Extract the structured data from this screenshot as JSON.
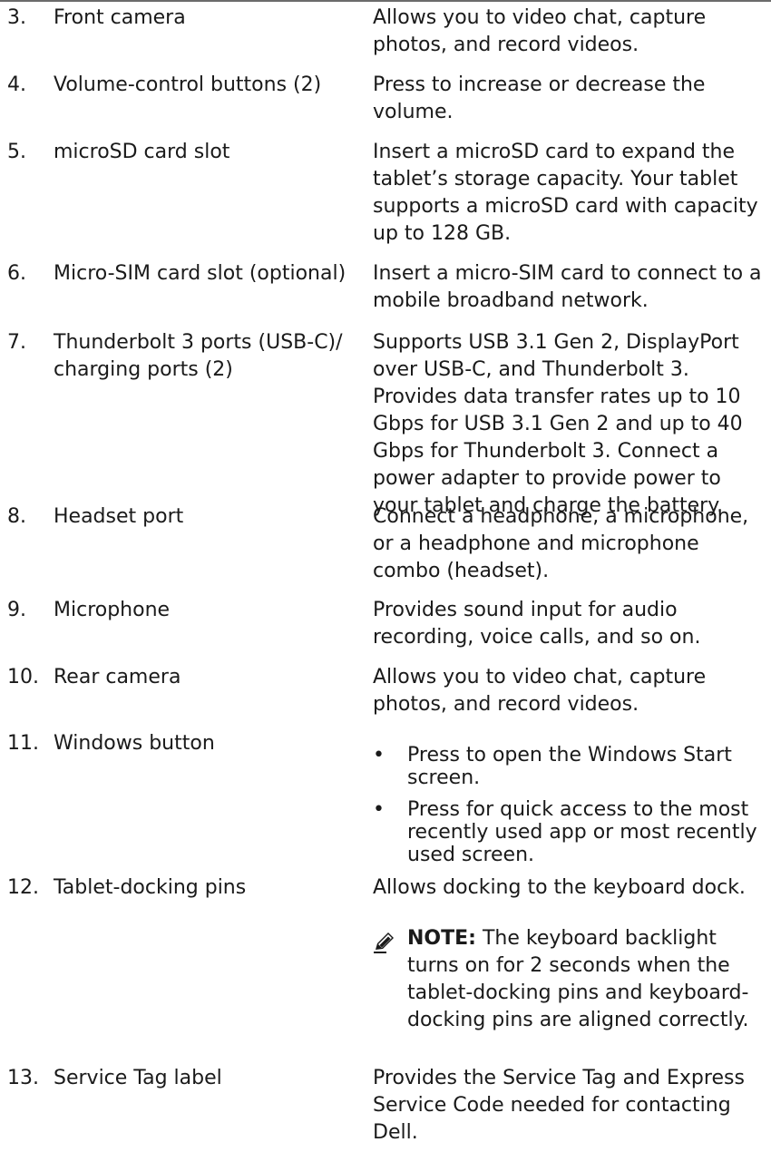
{
  "rows": [
    {
      "number": "3.",
      "name": "Front camera",
      "description": "Allows you to video chat, capture photos, and record videos."
    },
    {
      "number": "4.",
      "name": "Volume-control buttons (2)",
      "description": "Press to increase or decrease the volume."
    },
    {
      "number": "5.",
      "name": "microSD card slot",
      "description": "Insert a microSD card to expand the tablet’s storage capacity. Your tablet supports a microSD card with capacity up to 128 GB."
    },
    {
      "number": "6.",
      "name": "Micro-SIM card slot (optional)",
      "description": "Insert a micro-SIM card to connect to a mobile broadband network."
    },
    {
      "number": "7.",
      "name": "Thunderbolt 3 ports (USB-C)/ charging ports (2)",
      "description": "Supports USB 3.1 Gen 2, DisplayPort over USB-C, and Thunderbolt 3. Provides data transfer rates up to 10 Gbps for USB 3.1 Gen 2 and up to 40 Gbps for Thunderbolt 3. Connect a power adapter to provide power to your tablet and charge the battery."
    },
    {
      "number": "8.",
      "name": "Headset port",
      "description": "Connect a headphone, a microphone, or a headphone and microphone combo (headset)."
    },
    {
      "number": "9.",
      "name": "Microphone",
      "description": "Provides sound input for audio recording, voice calls, and so on."
    },
    {
      "number": "10.",
      "name": "Rear camera",
      "description": "Allows you to video chat, capture photos, and record videos."
    },
    {
      "number": "11.",
      "name": "Windows button",
      "bullets": [
        "Press to open the Windows Start screen.",
        "Press for quick access to the most recently used app or most recently used screen."
      ]
    },
    {
      "number": "12.",
      "name": "Tablet-docking pins",
      "description": "Allows docking to the keyboard dock.",
      "note": {
        "label": "NOTE:",
        "text": "The keyboard backlight turns on for 2 seconds when the tablet-docking pins and keyboard-docking pins are aligned correctly."
      }
    },
    {
      "number": "13.",
      "name": "Service Tag label",
      "description": "Provides the Service Tag and Express Service Code needed for contacting Dell."
    }
  ],
  "bullet_glyph": "•",
  "note_icon": "pencil-note-icon"
}
